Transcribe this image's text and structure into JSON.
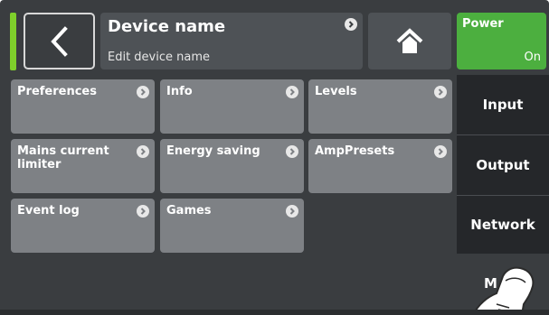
{
  "header": {
    "back_icon": "chevron-left-icon",
    "device_title": "Device name",
    "device_subtitle": "Edit device name",
    "home_icon": "home-icon",
    "power_label": "Power",
    "power_state": "On",
    "indicator_color": "#7fcf2b",
    "power_color": "#4caf3f"
  },
  "tiles": [
    {
      "label": "Preferences",
      "icon": "chevron-right-circle-icon"
    },
    {
      "label": "Info",
      "icon": "chevron-right-circle-icon"
    },
    {
      "label": "Levels",
      "icon": "chevron-right-circle-icon"
    },
    {
      "label": "Mains current limiter",
      "icon": "chevron-right-circle-icon"
    },
    {
      "label": "Energy saving",
      "icon": "chevron-right-circle-icon"
    },
    {
      "label": "AmpPresets",
      "icon": "chevron-right-circle-icon"
    },
    {
      "label": "Event log",
      "icon": "chevron-right-circle-icon"
    },
    {
      "label": "Games",
      "icon": "chevron-right-circle-icon"
    }
  ],
  "side_nav": {
    "items": [
      {
        "label": "Input"
      },
      {
        "label": "Output"
      },
      {
        "label": "Network"
      }
    ],
    "partial_label": "M"
  },
  "overlay": {
    "icon": "pointing-hand-icon"
  }
}
